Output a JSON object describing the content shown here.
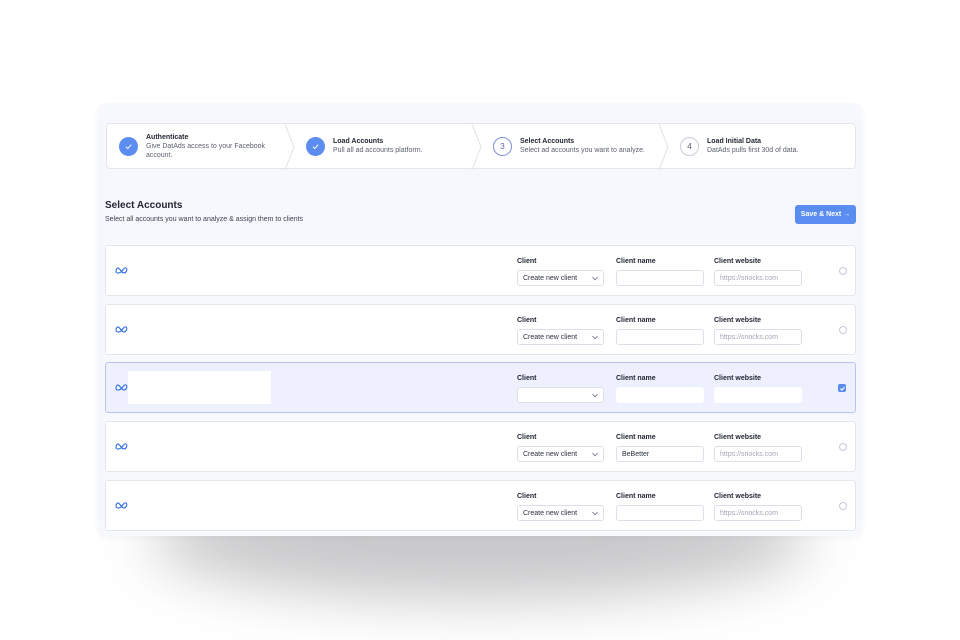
{
  "stepper": [
    {
      "title": "Authenticate",
      "desc": "Give DatAds access to your Facebook account.",
      "state": "done",
      "marker": "✓"
    },
    {
      "title": "Load Accounts",
      "desc": "Pull all ad accounts platform.",
      "state": "done",
      "marker": "✓"
    },
    {
      "title": "Select Accounts",
      "desc": "Select ad accounts you want to analyze.",
      "state": "current",
      "marker": "3"
    },
    {
      "title": "Load Initial Data",
      "desc": "DatAds pulls first 30d of data.",
      "state": "todo",
      "marker": "4"
    }
  ],
  "header": {
    "title": "Select Accounts",
    "subtitle": "Select all accounts you want to analyze & assign them to clients",
    "save_label": "Save & Next →"
  },
  "columns": {
    "client": "Client",
    "client_name": "Client name",
    "client_website": "Client website"
  },
  "rows": [
    {
      "client": "Create new client",
      "name": "",
      "website_placeholder": "https://snocks.com",
      "selected": false
    },
    {
      "client": "Create new client",
      "name": "",
      "website_placeholder": "https://snocks.com",
      "selected": false
    },
    {
      "client": "",
      "name": "",
      "website_placeholder": "",
      "selected": true
    },
    {
      "client": "Create new client",
      "name": "BeBetter",
      "website_placeholder": "https://snocks.com",
      "selected": false
    },
    {
      "client": "Create new client",
      "name": "",
      "website_placeholder": "https://snocks.com",
      "selected": false
    }
  ],
  "icons": {
    "platform": "meta-icon",
    "dropdown": "chevron-down-icon",
    "done": "checkmark-icon"
  },
  "colors": {
    "accent": "#5a8def",
    "card_bg": "#f7f8fd",
    "selected_row_bg": "#eef1fd"
  }
}
